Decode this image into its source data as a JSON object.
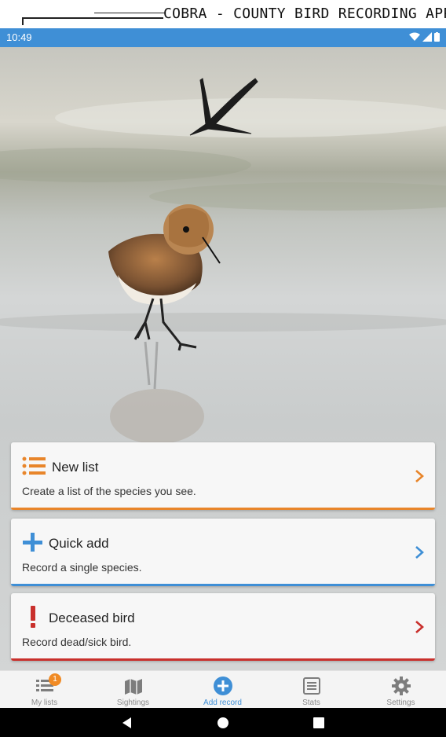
{
  "header": {
    "logo_text": "COBRA - COUNTY BIRD RECORDING APPIC"
  },
  "status_bar": {
    "time": "10:49"
  },
  "actions": [
    {
      "title": "New list",
      "subtitle": "Create a list of the species you see.",
      "icon": "list-icon",
      "color": "#e8852a"
    },
    {
      "title": "Quick add",
      "subtitle": "Record a single species.",
      "icon": "plus-icon",
      "color": "#3f8fd6"
    },
    {
      "title": "Deceased bird",
      "subtitle": "Record dead/sick bird.",
      "icon": "exclamation-icon",
      "color": "#c9302c"
    }
  ],
  "bottom_nav": [
    {
      "label": "My lists",
      "icon": "list-icon",
      "badge": "1"
    },
    {
      "label": "Sightings",
      "icon": "map-icon"
    },
    {
      "label": "Add record",
      "icon": "add-circle-icon",
      "active_color": "#3f8fd6"
    },
    {
      "label": "Stats",
      "icon": "stats-icon"
    },
    {
      "label": "Settings",
      "icon": "gear-icon"
    }
  ]
}
